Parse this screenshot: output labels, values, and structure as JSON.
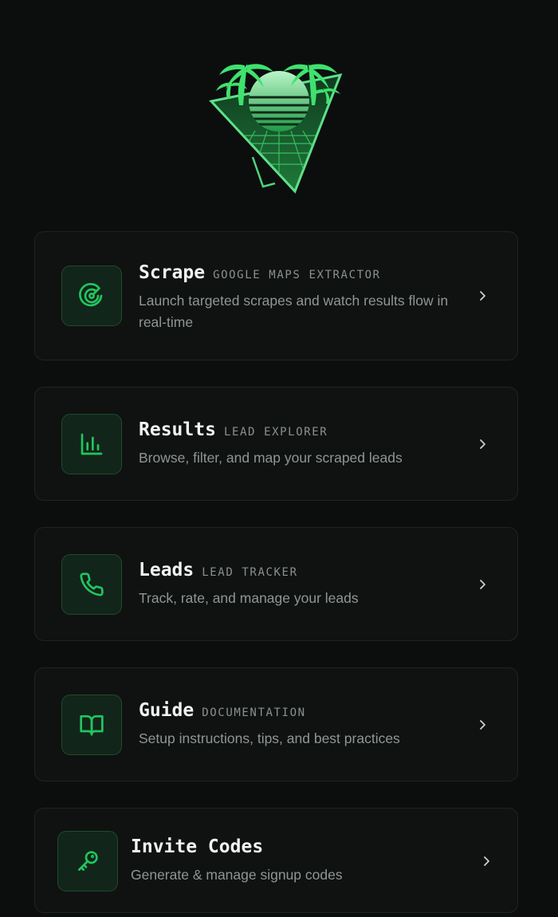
{
  "colors": {
    "accent": "#22c55e",
    "background": "#0c0e0e",
    "card": "#0f1211",
    "card_border": "#1e2422",
    "icon_bg": "#12251a",
    "title": "#f2f4f3",
    "muted": "#8f9693"
  },
  "logo": {
    "icon": "retro-sunset-palm-triangle-logo"
  },
  "menu": {
    "items": [
      {
        "icon": "radar-icon",
        "title": "Scrape",
        "subtitle": "GOOGLE MAPS EXTRACTOR",
        "description": "Launch targeted scrapes and watch results flow in real-time"
      },
      {
        "icon": "bar-chart-icon",
        "title": "Results",
        "subtitle": "LEAD EXPLORER",
        "description": "Browse, filter, and map your scraped leads"
      },
      {
        "icon": "phone-icon",
        "title": "Leads",
        "subtitle": "LEAD TRACKER",
        "description": "Track, rate, and manage your leads"
      },
      {
        "icon": "book-open-icon",
        "title": "Guide",
        "subtitle": "DOCUMENTATION",
        "description": "Setup instructions, tips, and best practices"
      },
      {
        "icon": "key-icon",
        "title": "Invite Codes",
        "subtitle": "",
        "description": "Generate & manage signup codes"
      }
    ]
  }
}
